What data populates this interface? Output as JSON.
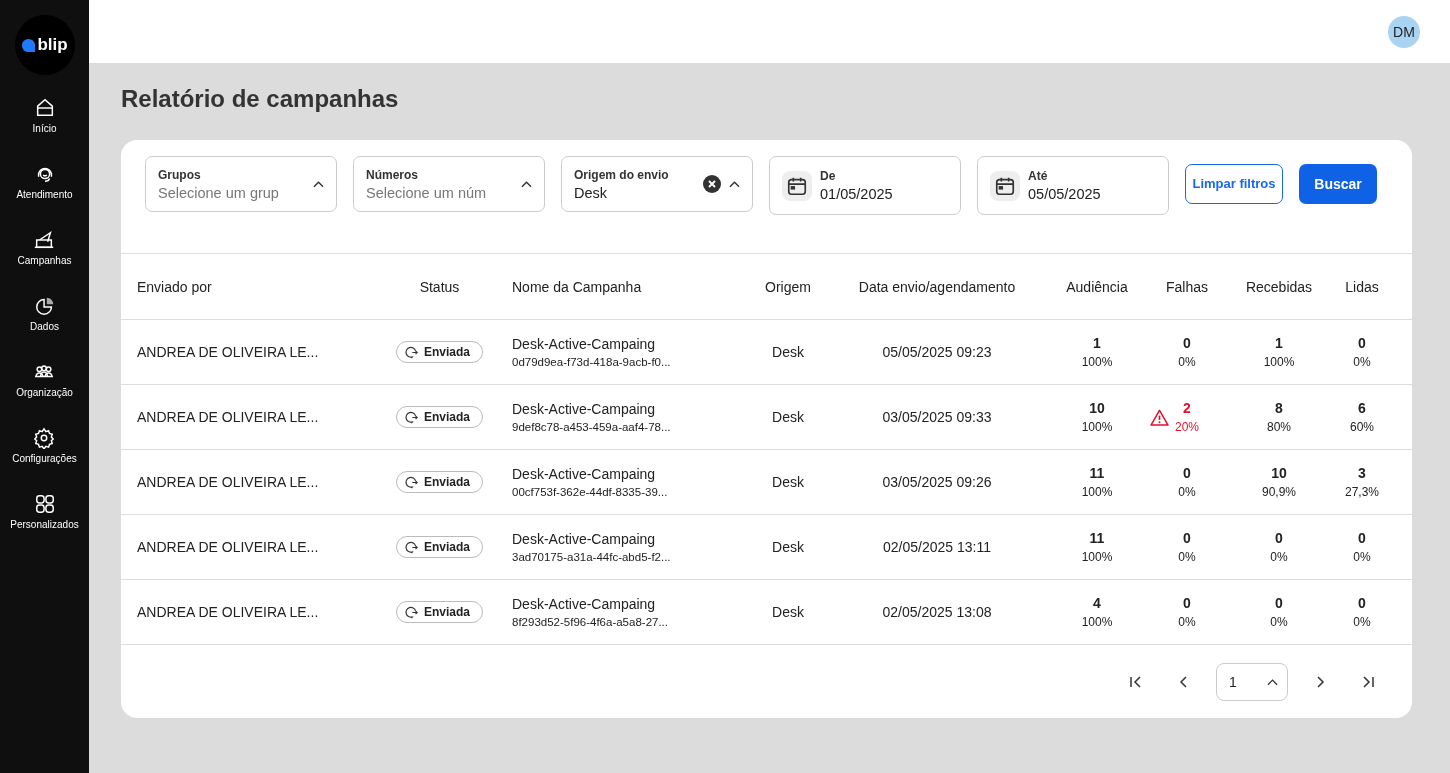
{
  "sidebar": {
    "logo": "blip",
    "items": [
      {
        "label": "Início"
      },
      {
        "label": "Atendimento"
      },
      {
        "label": "Campanhas"
      },
      {
        "label": "Dados"
      },
      {
        "label": "Organização"
      },
      {
        "label": "Configurações"
      },
      {
        "label": "Personalizados"
      }
    ]
  },
  "header": {
    "avatar": "DM"
  },
  "page_title": "Relatório de campanhas",
  "filters": [
    {
      "kind": "select",
      "label": "Grupos",
      "placeholder": "Selecione um grup",
      "clearable": false
    },
    {
      "kind": "select",
      "label": "Números",
      "placeholder": "Selecione um núm",
      "clearable": false
    },
    {
      "kind": "select",
      "label": "Origem do envio",
      "value": "Desk",
      "clearable": true
    },
    {
      "kind": "date",
      "label": "De",
      "value": "01/05/2025"
    },
    {
      "kind": "date",
      "label": "Até",
      "value": "05/05/2025"
    }
  ],
  "buttons": {
    "clear": "Limpar filtros",
    "search": "Buscar"
  },
  "table": {
    "columns": [
      "Enviado por",
      "Status",
      "Nome da Campanha",
      "Origem",
      "Data envio/agendamento",
      "Audiência",
      "Falhas",
      "Recebidas",
      "Lidas"
    ],
    "rows": [
      {
        "sender": "ANDREA DE OLIVEIRA LE...",
        "status": "Enviada",
        "campaign": "Desk-Active-Campaing",
        "campaign_id": "0d79d9ea-f73d-418a-9acb-f0...",
        "origin": "Desk",
        "date": "05/05/2025 09:23",
        "audience": [
          "1",
          "100%"
        ],
        "failures": [
          "0",
          "0%"
        ],
        "failure_alert": false,
        "received": [
          "1",
          "100%"
        ],
        "read": [
          "0",
          "0%"
        ]
      },
      {
        "sender": "ANDREA DE OLIVEIRA LE...",
        "status": "Enviada",
        "campaign": "Desk-Active-Campaing",
        "campaign_id": "9def8c78-a453-459a-aaf4-78...",
        "origin": "Desk",
        "date": "03/05/2025 09:33",
        "audience": [
          "10",
          "100%"
        ],
        "failures": [
          "2",
          "20%"
        ],
        "failure_alert": true,
        "received": [
          "8",
          "80%"
        ],
        "read": [
          "6",
          "60%"
        ]
      },
      {
        "sender": "ANDREA DE OLIVEIRA LE...",
        "status": "Enviada",
        "campaign": "Desk-Active-Campaing",
        "campaign_id": "00cf753f-362e-44df-8335-39...",
        "origin": "Desk",
        "date": "03/05/2025 09:26",
        "audience": [
          "11",
          "100%"
        ],
        "failures": [
          "0",
          "0%"
        ],
        "failure_alert": false,
        "received": [
          "10",
          "90,9%"
        ],
        "read": [
          "3",
          "27,3%"
        ]
      },
      {
        "sender": "ANDREA DE OLIVEIRA LE...",
        "status": "Enviada",
        "campaign": "Desk-Active-Campaing",
        "campaign_id": "3ad70175-a31a-44fc-abd5-f2...",
        "origin": "Desk",
        "date": "02/05/2025 13:11",
        "audience": [
          "11",
          "100%"
        ],
        "failures": [
          "0",
          "0%"
        ],
        "failure_alert": false,
        "received": [
          "0",
          "0%"
        ],
        "read": [
          "0",
          "0%"
        ]
      },
      {
        "sender": "ANDREA DE OLIVEIRA LE...",
        "status": "Enviada",
        "campaign": "Desk-Active-Campaing",
        "campaign_id": "8f293d52-5f96-4f6a-a5a8-27...",
        "origin": "Desk",
        "date": "02/05/2025 13:08",
        "audience": [
          "4",
          "100%"
        ],
        "failures": [
          "0",
          "0%"
        ],
        "failure_alert": false,
        "received": [
          "0",
          "0%"
        ],
        "read": [
          "0",
          "0%"
        ]
      }
    ]
  },
  "pagination": {
    "page": "1"
  }
}
